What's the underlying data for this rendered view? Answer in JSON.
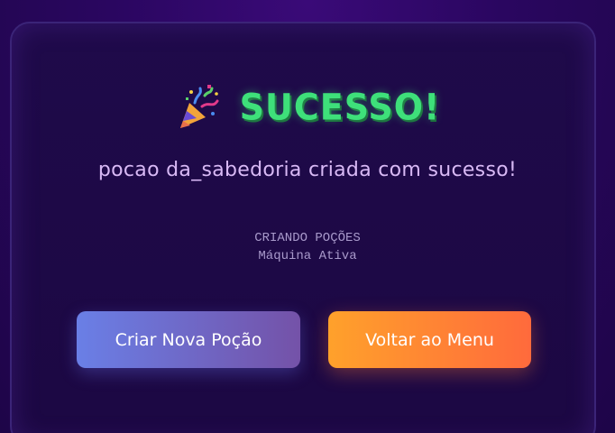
{
  "result": {
    "icon": "party-popper-icon",
    "title": "SUCESSO!",
    "message": "pocao da_sabedoria criada com sucesso!",
    "status_line_1": "CRIANDO POÇÕES",
    "status_line_2": "Máquina Ativa"
  },
  "actions": {
    "create_label": "Criar Nova Poção",
    "menu_label": "Voltar ao Menu"
  },
  "colors": {
    "title": "#3ee07a",
    "message": "#d8b9f5",
    "create_button": "#6a7fe6",
    "menu_button": "#ff8a34",
    "background": "#2a0660"
  }
}
